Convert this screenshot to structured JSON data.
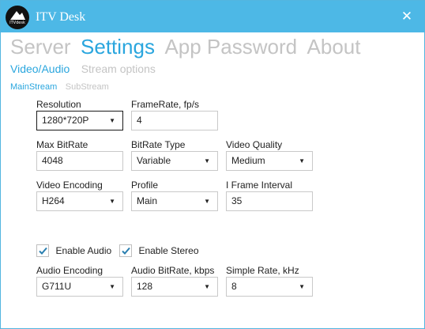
{
  "window": {
    "title": "ITV Desk",
    "logo_text": "ITVdesk",
    "close_glyph": "✕",
    "accent_color": "#4db8e6"
  },
  "main_tabs": [
    {
      "label": "Server",
      "active": false
    },
    {
      "label": "Settings",
      "active": true
    },
    {
      "label": "App Password",
      "active": false
    },
    {
      "label": "About",
      "active": false
    }
  ],
  "sub_tabs": [
    {
      "label": "Video/Audio",
      "active": true
    },
    {
      "label": "Stream options",
      "active": false
    }
  ],
  "stream_tabs": [
    {
      "label": "MainStream",
      "active": true
    },
    {
      "label": "SubStream",
      "active": false
    }
  ],
  "video": {
    "resolution": {
      "label": "Resolution",
      "value": "1280*720P"
    },
    "framerate": {
      "label": "FrameRate, fp/s",
      "value": "4"
    },
    "max_bitrate": {
      "label": "Max BitRate",
      "value": "4048"
    },
    "bitrate_type": {
      "label": "BitRate Type",
      "value": "Variable"
    },
    "video_quality": {
      "label": "Video Quality",
      "value": "Medium"
    },
    "video_encoding": {
      "label": "Video Encoding",
      "value": "H264"
    },
    "profile": {
      "label": "Profile",
      "value": "Main"
    },
    "iframe_interval": {
      "label": "I Frame Interval",
      "value": "35"
    }
  },
  "audio": {
    "enable_audio": {
      "label": "Enable Audio",
      "checked": true
    },
    "enable_stereo": {
      "label": "Enable Stereo",
      "checked": true
    },
    "audio_encoding": {
      "label": "Audio Encoding",
      "value": "G711U"
    },
    "audio_bitrate": {
      "label": "Audio BitRate, kbps",
      "value": "128"
    },
    "sample_rate": {
      "label": "Simple Rate, kHz",
      "value": "8"
    }
  },
  "dropdown_arrow": "▼",
  "check_color": "#2a7fb0"
}
